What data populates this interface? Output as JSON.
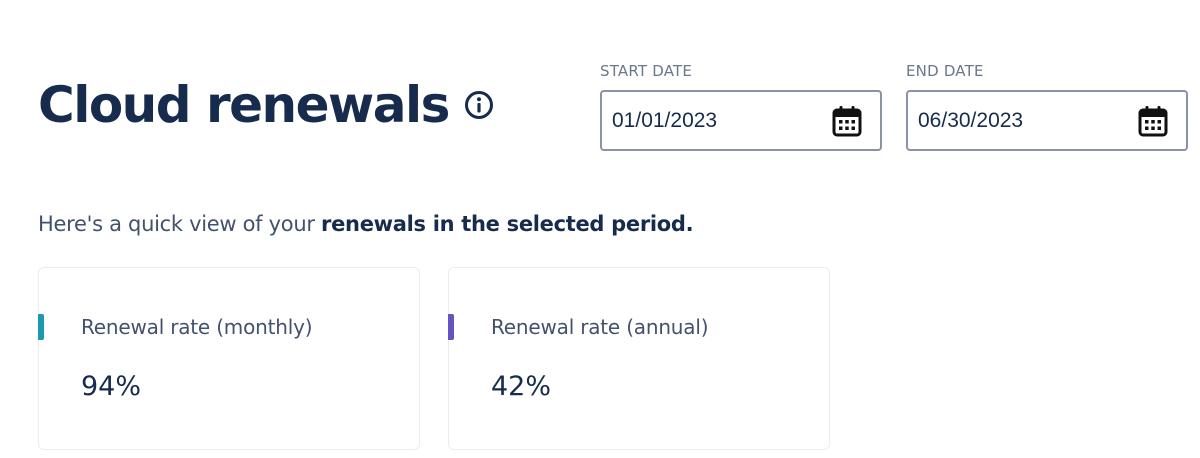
{
  "header": {
    "title": "Cloud renewals",
    "info_icon": "info-icon"
  },
  "date_range": {
    "start": {
      "label": "START DATE",
      "value": "01/01/2023",
      "icon": "calendar-icon"
    },
    "end": {
      "label": "END DATE",
      "value": "06/30/2023",
      "icon": "calendar-icon"
    }
  },
  "summary": {
    "prefix": "Here's a quick view of your ",
    "emphasis": "renewals in the selected period."
  },
  "cards": [
    {
      "label": "Renewal rate (monthly)",
      "value": "94%",
      "accent_color": "#1d9aaa"
    },
    {
      "label": "Renewal rate (annual)",
      "value": "42%",
      "accent_color": "#6554c0"
    }
  ],
  "colors": {
    "text_primary": "#172b4d",
    "text_secondary": "#42526e",
    "label_muted": "#6b778c",
    "field_border": "#8993a4"
  }
}
